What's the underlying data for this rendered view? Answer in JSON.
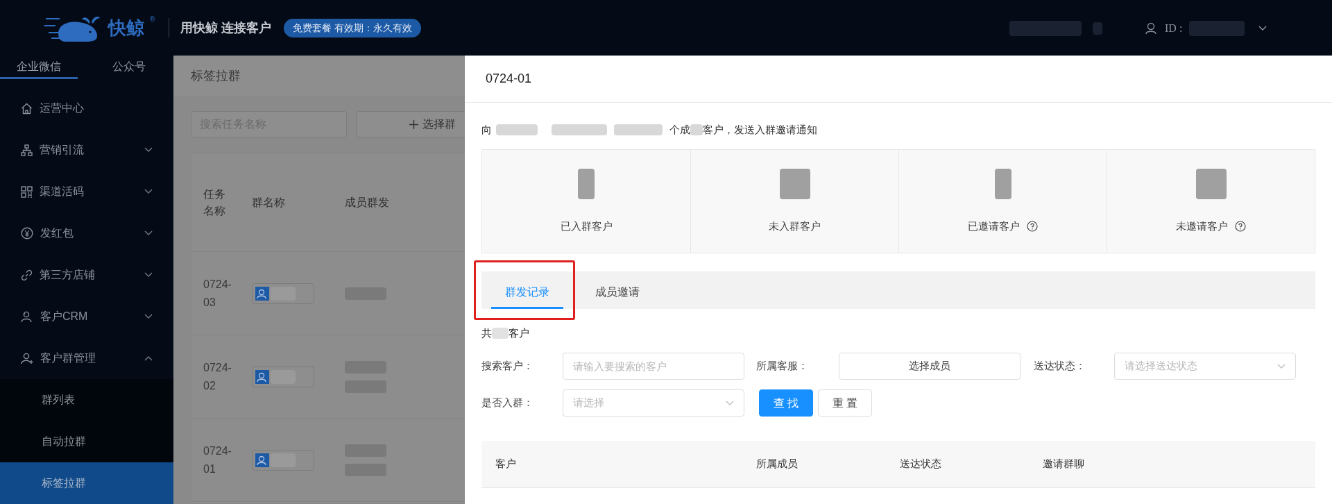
{
  "header": {
    "logo_text": "快鲸",
    "logo_mark": "®",
    "slogan": "用快鲸 连接客户",
    "plan_badge": "免费套餐 有效期：永久有效",
    "id_label": "ID :"
  },
  "sidebar": {
    "tabs": [
      {
        "label": "企业微信",
        "selected": true
      },
      {
        "label": "公众号",
        "selected": false
      }
    ],
    "items": [
      {
        "kind": "link",
        "label": "运营中心"
      },
      {
        "kind": "group",
        "label": "营销引流",
        "expanded": false
      },
      {
        "kind": "group",
        "label": "渠道活码",
        "expanded": false
      },
      {
        "kind": "group",
        "label": "发红包",
        "expanded": false
      },
      {
        "kind": "group",
        "label": "第三方店铺",
        "expanded": false
      },
      {
        "kind": "group",
        "label": "客户CRM",
        "expanded": false
      },
      {
        "kind": "group",
        "label": "客户群管理",
        "expanded": true,
        "children": [
          {
            "label": "群列表",
            "selected": false
          },
          {
            "label": "自动拉群",
            "selected": false
          },
          {
            "label": "标签拉群",
            "selected": true
          }
        ]
      }
    ]
  },
  "main": {
    "title": "标签拉群",
    "search": {
      "placeholder": "搜索任务名称"
    },
    "add_button": "选择群",
    "table": {
      "columns": [
        "任务名称",
        "群名称",
        "成员群发"
      ],
      "rows": [
        {
          "task": "0724-03"
        },
        {
          "task": "0724-02"
        },
        {
          "task": "0724-01"
        }
      ]
    }
  },
  "drawer": {
    "title": "0724-01",
    "notice": [
      "向",
      "个成",
      "客户，发送入群邀请通知"
    ],
    "stats": [
      {
        "label": "已入群客户",
        "help": false
      },
      {
        "label": "未入群客户",
        "help": false
      },
      {
        "label": "已邀请客户",
        "help": true
      },
      {
        "label": "未邀请客户",
        "help": true
      }
    ],
    "tabs": [
      {
        "label": "群发记录",
        "selected": true
      },
      {
        "label": "成员邀请",
        "selected": false
      }
    ],
    "count": [
      "共",
      "客户"
    ],
    "filters": [
      {
        "kind": "input",
        "label": "搜索客户：",
        "placeholder": "请输入要搜索的客户"
      },
      {
        "kind": "button",
        "label": "所属客服：",
        "value": "选择成员"
      },
      {
        "kind": "select",
        "label": "送达状态：",
        "placeholder": "请选择送达状态"
      },
      {
        "kind": "select",
        "label": "是否入群：",
        "placeholder": "请选择"
      }
    ],
    "actions": [
      {
        "kind": "primary",
        "label": "查 找"
      },
      {
        "kind": "default",
        "label": "重 置"
      }
    ],
    "table": {
      "columns": [
        "客户",
        "所属成员",
        "送达状态",
        "邀请群聊"
      ]
    }
  }
}
